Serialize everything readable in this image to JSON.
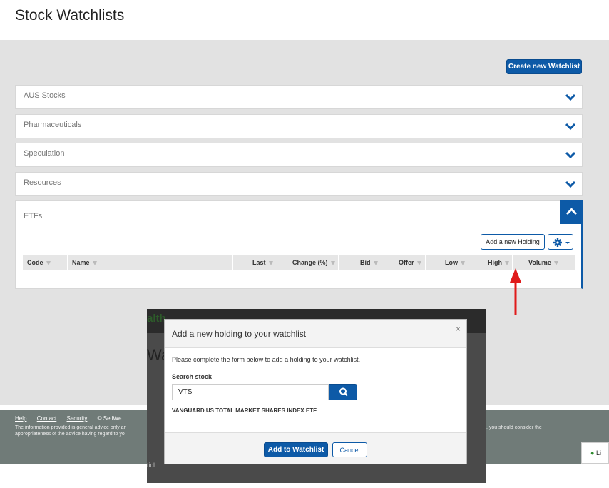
{
  "page": {
    "title": "Stock Watchlists"
  },
  "toolbar": {
    "create_label": "Create new Watchlist"
  },
  "watchlists": [
    {
      "label": "AUS Stocks"
    },
    {
      "label": "Pharmaceuticals"
    },
    {
      "label": "Speculation"
    },
    {
      "label": "Resources"
    }
  ],
  "etf": {
    "label": "ETFs",
    "add_holding_label": "Add a new Holding",
    "columns": [
      "Code",
      "Name",
      "Last",
      "Change (%)",
      "Bid",
      "Offer",
      "Low",
      "High",
      "Volume"
    ]
  },
  "footer": {
    "links": [
      "Help",
      "Contact",
      "Security"
    ],
    "copyright": "© SelfWe",
    "disclaimer_line1": "The information provided is general advice only ar",
    "disclaimer_line2": "appropriateness of the advice having regard to yo",
    "disclaimer_right": ", you should consider the"
  },
  "chat": {
    "label": "Li"
  },
  "background_overlay": {
    "brand_fragment": "alth",
    "heading_fragment": "Wa",
    "side_fragment": "ticl"
  },
  "modal": {
    "title": "Add a new holding to your watchlist",
    "close": "×",
    "instructions": "Please complete the form below to add a holding to your watchlist.",
    "search_label": "Search stock",
    "search_value": "VTS",
    "result": "VANGUARD US TOTAL MARKET SHARES INDEX ETF",
    "add_label": "Add to Watchlist",
    "cancel_label": "Cancel"
  },
  "colors": {
    "brand_blue": "#0d5aa7",
    "page_gray": "#e2e2e2",
    "footer": "#707b78",
    "arrow": "#e01b1b"
  },
  "icons": {
    "expand": "chevron-down-icon",
    "collapse": "chevron-up-icon",
    "settings": "gear-icon",
    "search": "search-icon",
    "chat": "chat-icon",
    "close": "close-icon"
  }
}
